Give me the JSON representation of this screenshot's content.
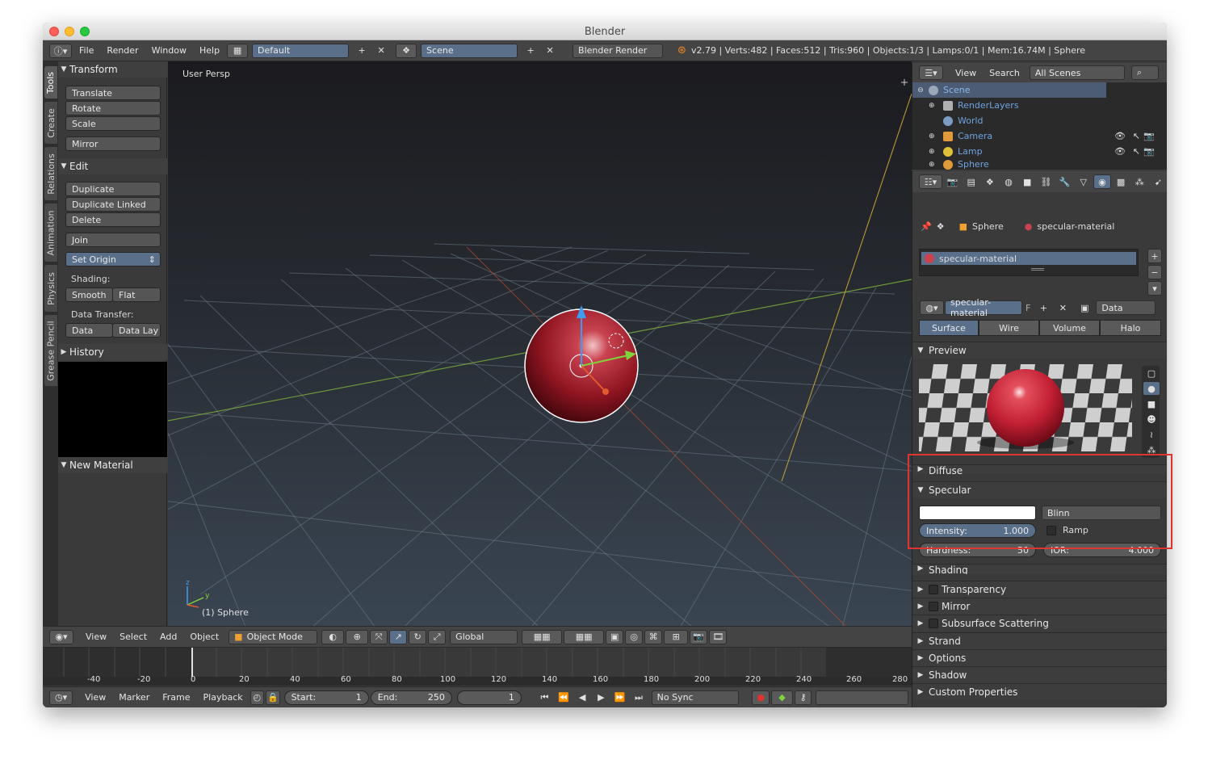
{
  "window": {
    "title": "Blender"
  },
  "topbar": {
    "menu": [
      "File",
      "Render",
      "Window",
      "Help"
    ],
    "layout": "Default",
    "scene": "Scene",
    "engine": "Blender Render",
    "stats": "v2.79 | Verts:482 | Faces:512 | Tris:960 | Objects:1/3 | Lamps:0/1 | Mem:16.74M | Sphere"
  },
  "tabs": [
    "Tools",
    "Create",
    "Relations",
    "Animation",
    "Physics",
    "Grease Pencil"
  ],
  "toolshelf": {
    "transform": {
      "title": "Transform",
      "buttons": [
        "Translate",
        "Rotate",
        "Scale"
      ],
      "mirror": "Mirror"
    },
    "edit": {
      "title": "Edit",
      "buttons": [
        "Duplicate",
        "Duplicate Linked",
        "Delete"
      ],
      "join": "Join",
      "set_origin": "Set Origin"
    },
    "shading": {
      "label": "Shading:",
      "smooth": "Smooth",
      "flat": "Flat"
    },
    "data_transfer": {
      "label": "Data Transfer:",
      "data": "Data",
      "data_lay": "Data Lay"
    },
    "history": "History",
    "new_material": "New Material"
  },
  "viewport": {
    "view_name": "User Persp",
    "object_label": "(1) Sphere",
    "axis_z": "z",
    "axis_y": "y"
  },
  "view3d_header": {
    "menu": [
      "View",
      "Select",
      "Add",
      "Object"
    ],
    "mode": "Object Mode",
    "orientation": "Global"
  },
  "timeline": {
    "ticks": [
      "-40",
      "-20",
      "0",
      "20",
      "40",
      "60",
      "80",
      "100",
      "120",
      "140",
      "160",
      "180",
      "200",
      "220",
      "240",
      "260",
      "280"
    ]
  },
  "timeline_bar": {
    "menu": [
      "View",
      "Marker",
      "Frame",
      "Playback"
    ],
    "start_label": "Start:",
    "start": "1",
    "end_label": "End:",
    "end": "250",
    "current": "1",
    "sync": "No Sync"
  },
  "outliner": {
    "menu": [
      "View",
      "Search"
    ],
    "filter": "All Scenes",
    "rows": [
      "Scene",
      "RenderLayers",
      "World",
      "Camera",
      "Lamp",
      "Sphere"
    ]
  },
  "properties": {
    "context_object": "Sphere",
    "context_material": "specular-material",
    "slot": "specular-material",
    "material_name": "specular-material",
    "fake_user": "F",
    "link": "Data",
    "tabs": [
      "Surface",
      "Wire",
      "Volume",
      "Halo"
    ],
    "panels": {
      "preview": "Preview",
      "diffuse": "Diffuse",
      "specular": "Specular",
      "shading": "Shading",
      "transparency": "Transparency",
      "mirror": "Mirror",
      "sss": "Subsurface Scattering",
      "strand": "Strand",
      "options": "Options",
      "shadow": "Shadow",
      "custom": "Custom Properties"
    },
    "specular": {
      "shader": "Blinn",
      "intensity_label": "Intensity:",
      "intensity": "1.000",
      "ramp": "Ramp",
      "hardness_label": "Hardness:",
      "hardness": "50",
      "ior_label": "IOR:",
      "ior": "4.000",
      "color": "#ffffff"
    }
  },
  "colors": {
    "accent": "#5a6f8a",
    "highlight": "#e0342e",
    "sphere": "#b3222f"
  }
}
